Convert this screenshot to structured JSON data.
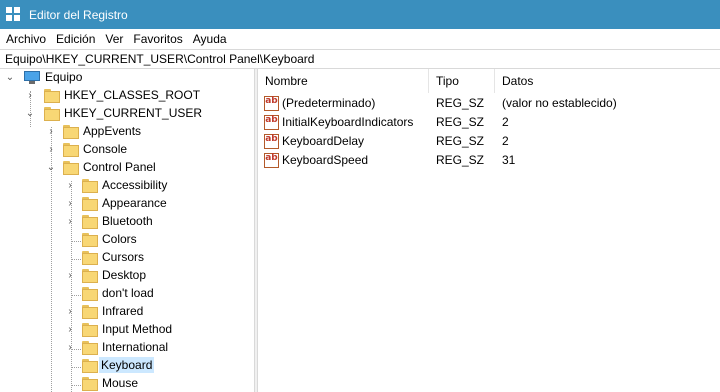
{
  "window": {
    "title": "Editor del Registro"
  },
  "menu": [
    "Archivo",
    "Edición",
    "Ver",
    "Favoritos",
    "Ayuda"
  ],
  "address": "Equipo\\HKEY_CURRENT_USER\\Control Panel\\Keyboard",
  "tree": {
    "root": "Equipo",
    "hives": [
      "HKEY_CLASSES_ROOT",
      "HKEY_CURRENT_USER"
    ],
    "hkcu_children": [
      "AppEvents",
      "Console",
      "Control Panel"
    ],
    "control_panel_children": [
      "Accessibility",
      "Appearance",
      "Bluetooth",
      "Colors",
      "Cursors",
      "Desktop",
      "don't load",
      "Infrared",
      "Input Method",
      "International",
      "Keyboard",
      "Mouse"
    ]
  },
  "list": {
    "columns": [
      "Nombre",
      "Tipo",
      "Datos"
    ],
    "rows": [
      {
        "name": "(Predeterminado)",
        "type": "REG_SZ",
        "data": "(valor no establecido)"
      },
      {
        "name": "InitialKeyboardIndicators",
        "type": "REG_SZ",
        "data": "2"
      },
      {
        "name": "KeyboardDelay",
        "type": "REG_SZ",
        "data": "2"
      },
      {
        "name": "KeyboardSpeed",
        "type": "REG_SZ",
        "data": "31"
      }
    ]
  },
  "icons": {
    "value": "string-value-icon",
    "folder": "folder-icon",
    "computer": "computer-icon"
  },
  "colors": {
    "titlebar": "#3a8fbe",
    "selection": "#cce8ff",
    "folder": "#f8d775"
  }
}
